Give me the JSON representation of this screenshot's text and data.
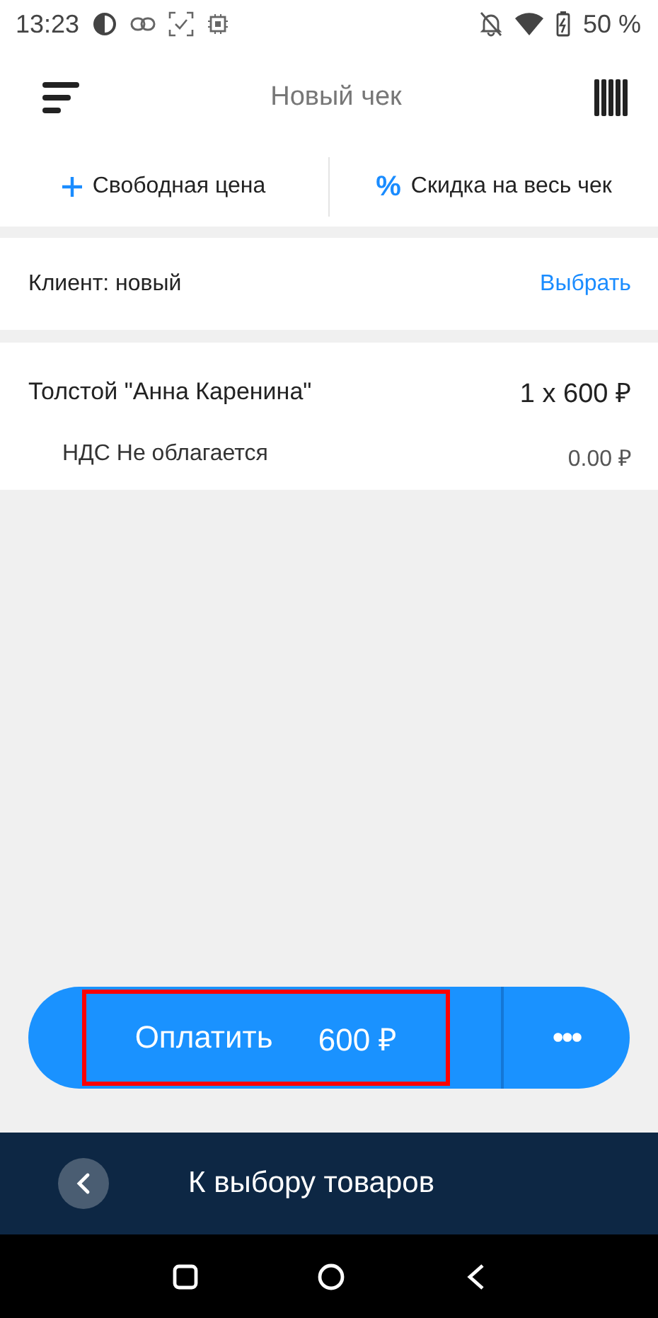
{
  "status_bar": {
    "time": "13:23",
    "battery": "50 %"
  },
  "header": {
    "title": "Новый чек"
  },
  "actions": [
    {
      "kind": "plus",
      "label": "Свободная цена"
    },
    {
      "kind": "percent",
      "icon": "%",
      "label": "Скидка на весь чек"
    }
  ],
  "client": {
    "label": "Клиент: новый",
    "action": "Выбрать"
  },
  "items": [
    {
      "name": "Толстой \"Анна Каренина\"",
      "quantity": "1 x 600 ₽",
      "tax": "НДС Не облагается",
      "tax_amount": "0.00 ₽"
    }
  ],
  "pay_button": {
    "label": "Оплатить",
    "amount": "600 ₽",
    "highlighted": true
  },
  "more_button": {
    "label": "•••"
  },
  "bottom_bar": {
    "label": "К выбору товаров"
  }
}
